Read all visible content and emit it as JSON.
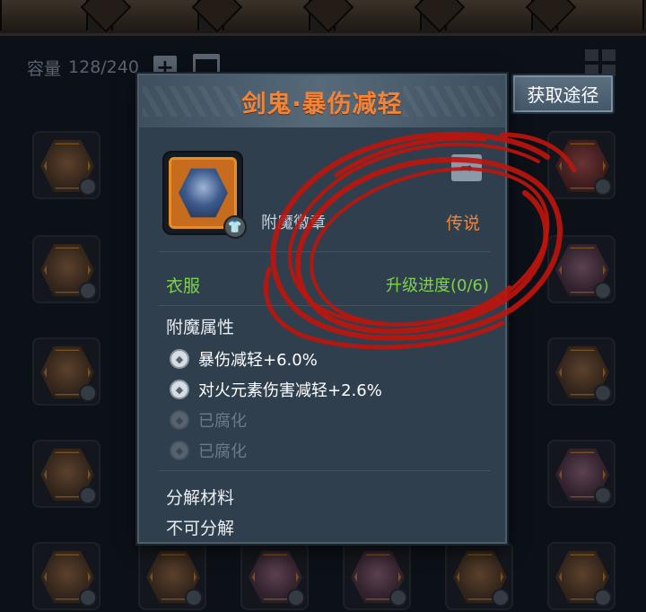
{
  "bag": {
    "capacity_label": "容量",
    "capacity_value": "128/240"
  },
  "popup": {
    "title": "剑鬼·暴伤减轻",
    "item_type": "附魔徽章",
    "rarity": "传说",
    "slot_type": "衣服",
    "upgrade_progress": "升级进度(0/6)",
    "enchant_title": "附魔属性",
    "attributes": [
      {
        "text": "暴伤减轻+6.0%",
        "state": "active"
      },
      {
        "text": "对火元素伤害减轻+2.6%",
        "state": "active"
      },
      {
        "text": "已腐化",
        "state": "corrupted"
      },
      {
        "text": "已腐化",
        "state": "corrupted"
      }
    ],
    "decompose_title": "分解材料",
    "decompose_value": "不可分解"
  },
  "obtain_button": {
    "label": "获取途径"
  },
  "icons": {
    "plus": "plus-icon",
    "broom": "broom-icon",
    "grid": "grid-view-icon",
    "share": "share-icon",
    "shirt": "clothing-icon"
  },
  "colors": {
    "title_orange": "#f0843a",
    "legendary_orange": "#f0843a",
    "green": "#7ed24c",
    "panel_bg": "#2f3f4d",
    "annotation_red": "#c0140c"
  }
}
